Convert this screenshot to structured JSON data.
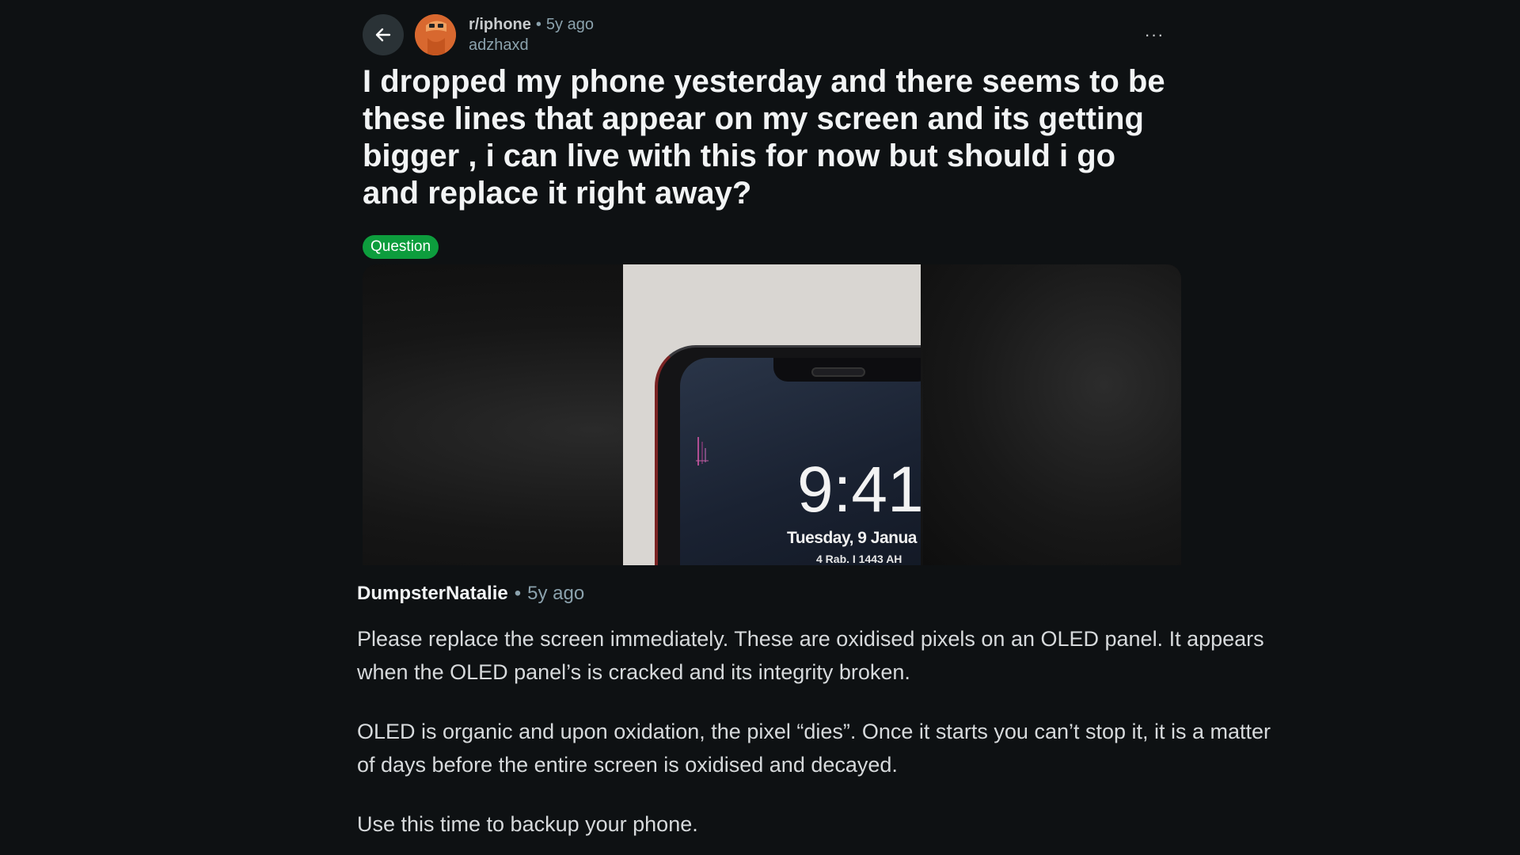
{
  "post": {
    "subreddit": "r/iphone",
    "separator": "•",
    "time_ago": "5y ago",
    "author": "adzhaxd",
    "more_label": "···",
    "title": "I dropped my phone yesterday and there seems to be these lines that appear on my screen and its getting bigger , i can live with this for now but should i go and replace it right away?",
    "flair": "Question",
    "flair_color": "#0d9d3d"
  },
  "media": {
    "clock": "9:41",
    "date": "Tuesday, 9 Janua",
    "hijri": "4 Rab. I 1443 AH"
  },
  "comment": {
    "author": "DumpsterNatalie",
    "separator": "•",
    "time_ago": "5y ago",
    "paragraphs": [
      "Please replace the screen immediately. These are oxidised pixels on an OLED panel. It appears when the OLED panel’s is cracked and its integrity broken.",
      "OLED is organic and upon oxidation, the pixel “dies”. Once it starts you can’t stop it, it is a matter of days before the entire screen is oxidised and decayed.",
      "Use this time to backup your phone."
    ]
  },
  "icons": {
    "back": "arrow-left-icon",
    "more": "more-horizontal-icon",
    "avatar": "subreddit-avatar"
  },
  "colors": {
    "background": "#0e1113",
    "text_primary": "#f2f4f5",
    "text_secondary": "#8ba2ad"
  }
}
